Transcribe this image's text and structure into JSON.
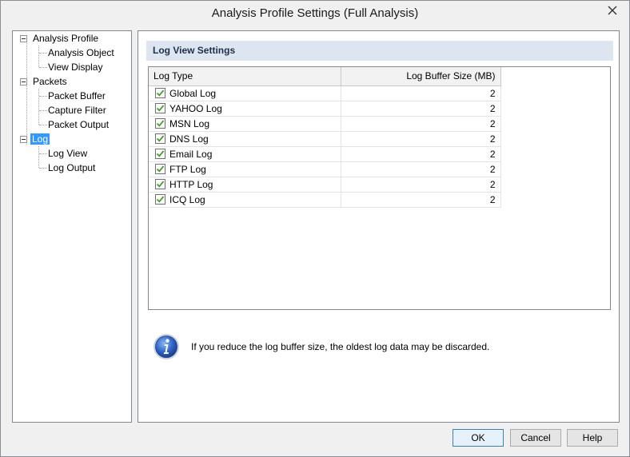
{
  "window": {
    "title": "Analysis Profile Settings (Full Analysis)"
  },
  "tree": {
    "nodes": [
      {
        "label": "Analysis Profile",
        "level": 0,
        "expanded": true
      },
      {
        "label": "Analysis Object",
        "level": 1
      },
      {
        "label": "View Display",
        "level": 1
      },
      {
        "label": "Packets",
        "level": 0,
        "expanded": true
      },
      {
        "label": "Packet Buffer",
        "level": 1
      },
      {
        "label": "Capture Filter",
        "level": 1
      },
      {
        "label": "Packet Output",
        "level": 1
      },
      {
        "label": "Log",
        "level": 0,
        "expanded": true,
        "selected": true
      },
      {
        "label": "Log View",
        "level": 1
      },
      {
        "label": "Log Output",
        "level": 1
      }
    ]
  },
  "section": {
    "title": "Log View Settings"
  },
  "grid": {
    "columns": [
      "Log Type",
      "Log Buffer Size (MB)"
    ],
    "rows": [
      {
        "name": "Global Log",
        "checked": true,
        "size": "2"
      },
      {
        "name": "YAHOO Log",
        "checked": true,
        "size": "2"
      },
      {
        "name": "MSN Log",
        "checked": true,
        "size": "2"
      },
      {
        "name": "DNS Log",
        "checked": true,
        "size": "2"
      },
      {
        "name": "Email Log",
        "checked": true,
        "size": "2"
      },
      {
        "name": "FTP Log",
        "checked": true,
        "size": "2"
      },
      {
        "name": "HTTP Log",
        "checked": true,
        "size": "2"
      },
      {
        "name": "ICQ Log",
        "checked": true,
        "size": "2"
      }
    ]
  },
  "info": {
    "icon": "info-icon",
    "text": "If you reduce the log buffer size, the oldest log data may be discarded."
  },
  "buttons": {
    "ok": "OK",
    "cancel": "Cancel",
    "help": "Help"
  },
  "colors": {
    "selection": "#3399ff",
    "section_header_bg": "#dde6f0",
    "checkmark": "#4a9a32"
  }
}
